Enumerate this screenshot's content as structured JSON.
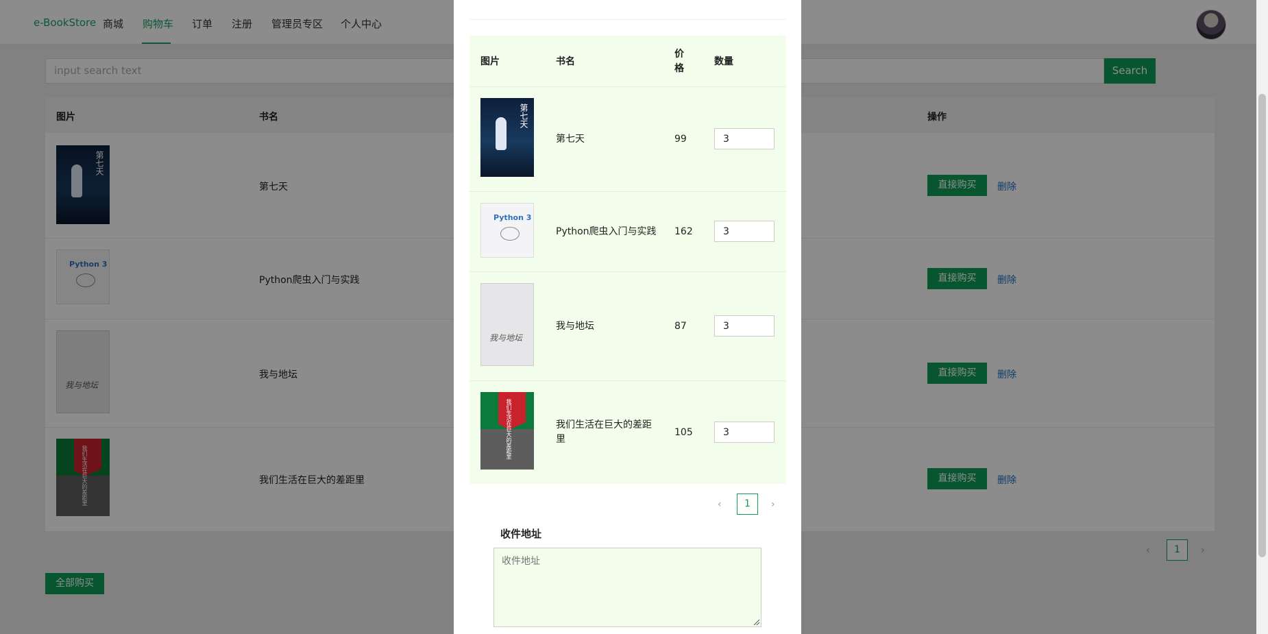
{
  "nav": {
    "brand": "e-BookStore",
    "items": [
      {
        "label": "商城",
        "active": false
      },
      {
        "label": "购物车",
        "active": true
      },
      {
        "label": "订单",
        "active": false
      },
      {
        "label": "注册",
        "active": false
      },
      {
        "label": "管理员专区",
        "active": false
      },
      {
        "label": "个人中心",
        "active": false
      }
    ]
  },
  "search": {
    "placeholder": "input search text",
    "button": "Search"
  },
  "cart_table": {
    "headers": {
      "image": "图片",
      "name": "书名",
      "actions": "操作"
    },
    "rows": [
      {
        "name": "第七天",
        "buy": "直接购买",
        "delete": "删除"
      },
      {
        "name": "Python爬虫入门与实践",
        "buy": "直接购买",
        "delete": "删除"
      },
      {
        "name": "我与地坛",
        "buy": "直接购买",
        "delete": "删除"
      },
      {
        "name": "我们生活在巨大的差距里",
        "buy": "直接购买",
        "delete": "删除"
      }
    ],
    "page": "1"
  },
  "buy_all": "全部购买",
  "modal": {
    "headers": {
      "image": "图片",
      "name": "书名",
      "price": "价格",
      "quantity": "数量"
    },
    "rows": [
      {
        "name": "第七天",
        "price": "99",
        "quantity": "3"
      },
      {
        "name": "Python爬虫入门与实践",
        "price": "162",
        "quantity": "3"
      },
      {
        "name": "我与地坛",
        "price": "87",
        "quantity": "3"
      },
      {
        "name": "我们生活在巨大的差距里",
        "price": "105",
        "quantity": "3"
      }
    ],
    "page": "1",
    "address_label": "收件地址",
    "address_placeholder": "收件地址"
  },
  "covers": {
    "c1_title": "第七天",
    "c2_title": "Python 3",
    "c3_title": "我与地坛",
    "c4_title": "我们生活在巨大的差距里"
  },
  "colors": {
    "accent": "#0f9d58",
    "modal_bg": "#f3fdeb",
    "link": "#1e6fbf"
  },
  "icons": {
    "prev": "chevron-left-icon",
    "next": "chevron-right-icon",
    "resize": "resize-handle-icon"
  }
}
